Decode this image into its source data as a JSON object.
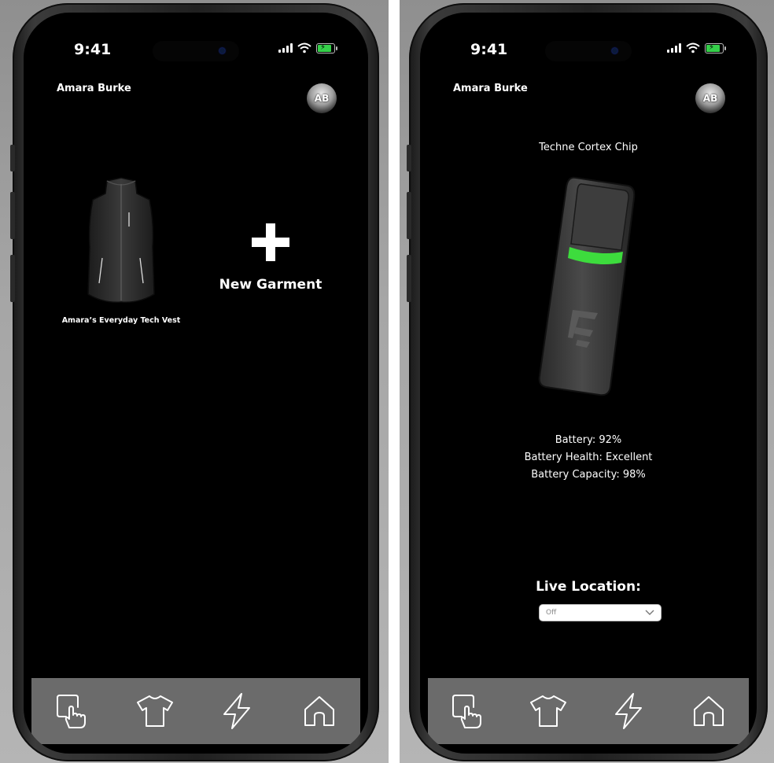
{
  "status_bar": {
    "time": "9:41"
  },
  "user": {
    "name": "Amara Burke",
    "initials": "AB"
  },
  "garments_screen": {
    "garment_label": "Amara’s Everyday Tech Vest",
    "new_garment_label": "New Garment"
  },
  "chip_screen": {
    "title": "Techne Cortex Chip",
    "battery": "Battery: 92%",
    "battery_health": "Battery Health: Excellent",
    "battery_capacity": "Battery Capacity: 98%",
    "live_location_label": "Live Location:",
    "live_location_value": "Off"
  },
  "nav": {
    "items": [
      {
        "icon": "tap-hand-icon"
      },
      {
        "icon": "tshirt-icon"
      },
      {
        "icon": "lightning-icon"
      },
      {
        "icon": "home-icon"
      }
    ]
  },
  "colors": {
    "screen_background": "#000000",
    "nav_bar": "#6b6b6b",
    "chip_accent": "#3ddc3d",
    "text": "#ffffff"
  }
}
